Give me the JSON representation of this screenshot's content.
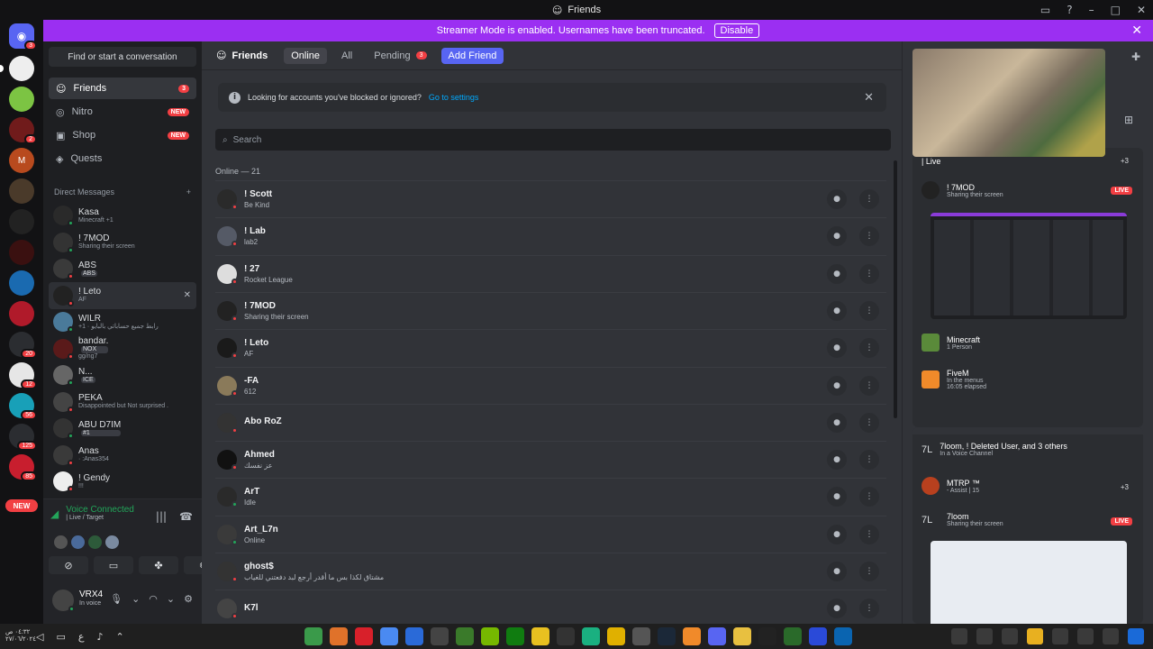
{
  "window": {
    "title": "Friends"
  },
  "banner": {
    "text": "Streamer Mode is enabled. Usernames have been truncated.",
    "disable_label": "Disable"
  },
  "servers": [
    {
      "badge": "3"
    },
    {
      "badge": ""
    },
    {
      "badge": ""
    },
    {
      "badge": "2"
    },
    {
      "badge": ""
    },
    {
      "badge": ""
    },
    {
      "badge": ""
    },
    {
      "badge": ""
    },
    {
      "badge": ""
    },
    {
      "badge": ""
    },
    {
      "badge": "20"
    },
    {
      "badge": "12"
    },
    {
      "badge": "56"
    },
    {
      "badge": "125"
    },
    {
      "badge": "85"
    },
    {
      "badge": ""
    }
  ],
  "servers_new_label": "NEW",
  "dm_sidebar": {
    "find_placeholder": "Find or start a conversation",
    "nav": [
      {
        "label": "Friends",
        "badge": "3"
      },
      {
        "label": "Nitro",
        "badge": "NEW"
      },
      {
        "label": "Shop",
        "badge": "NEW"
      },
      {
        "label": "Quests",
        "badge": ""
      }
    ],
    "dm_header": "Direct Messages",
    "dm_add": "+",
    "dms": [
      {
        "name": "Kasa",
        "sub": "Minecraft +1",
        "tag": "",
        "status": "online"
      },
      {
        "name": "! 7MOD",
        "sub": "Sharing their screen",
        "tag": "",
        "status": "online"
      },
      {
        "name": "ABS",
        "sub": "",
        "tag": "ABS",
        "status": "dnd"
      },
      {
        "name": "! Leto",
        "sub": "AF",
        "tag": "",
        "status": "dnd"
      },
      {
        "name": "WILR",
        "sub": "+1 · رابط جميع حساباتي بالبايو",
        "tag": "",
        "status": "online"
      },
      {
        "name": "bandar.",
        "sub": "gg/ng7",
        "tag": "NOX",
        "status": "dnd"
      },
      {
        "name": "N...",
        "sub": "",
        "tag": "ICE",
        "status": "online"
      },
      {
        "name": "PEKA",
        "sub": "Disappointed but Not surprised .",
        "tag": "",
        "status": "dnd"
      },
      {
        "name": "ABU D7IM",
        "sub": "",
        "tag": "#1",
        "status": "online"
      },
      {
        "name": "Anas",
        "sub": "· :Anas354",
        "tag": "",
        "status": "dnd"
      },
      {
        "name": "! Gendy",
        "sub": "!!!",
        "tag": "",
        "status": "dnd"
      }
    ]
  },
  "voice": {
    "title": "Voice Connected",
    "channel": "| Live / Target"
  },
  "user": {
    "name": "VRX4",
    "status": "In voice"
  },
  "toolbar": {
    "friends_label": "Friends",
    "tabs": [
      {
        "label": "Online",
        "badge": ""
      },
      {
        "label": "All",
        "badge": ""
      },
      {
        "label": "Pending",
        "badge": "3"
      }
    ],
    "add_friend_label": "Add Friend"
  },
  "notice": {
    "text": "Looking for accounts you've blocked or ignored?",
    "link": "Go to settings"
  },
  "search": {
    "placeholder": "Search"
  },
  "online_header": "Online — 21",
  "friends": [
    {
      "name": "! Scott",
      "sub": "Be Kind",
      "status": "dnd"
    },
    {
      "name": "! Lab",
      "sub": "lab2",
      "status": "dnd"
    },
    {
      "name": "! 27",
      "sub": "Rocket League",
      "status": "dnd"
    },
    {
      "name": "! 7MOD",
      "sub": "Sharing their screen",
      "status": "dnd"
    },
    {
      "name": "! Leto",
      "sub": "AF",
      "status": "dnd"
    },
    {
      "name": "-FA",
      "sub": "612",
      "status": "dnd"
    },
    {
      "name": "Abo RoZ",
      "sub": "",
      "status": "dnd"
    },
    {
      "name": "Ahmed",
      "sub": "عز نفسك",
      "status": "dnd"
    },
    {
      "name": "ArT",
      "sub": "Idle",
      "status": "online"
    },
    {
      "name": "Art_L7n",
      "sub": "Online",
      "status": "online"
    },
    {
      "name": "ghost$",
      "sub": "مشتاق لكذا بس ما أقدر أرجع لبد دفعتني للغياب",
      "status": "dnd"
    },
    {
      "name": "K7l",
      "sub": "",
      "status": "dnd"
    }
  ],
  "activity": {
    "card1_live_text": "| Live",
    "card1_more": "+3",
    "stream_user": "! 7MOD",
    "stream_sub": "Sharing their screen",
    "live_label": "LIVE",
    "games": [
      {
        "name": "Minecraft",
        "sub": "1 Person"
      },
      {
        "name": "FiveM",
        "sub": "In the menus",
        "sub2": "16:05 elapsed"
      }
    ],
    "card2_title": "7loom, ! Deleted User, and 3 others",
    "card2_sub": "In a Voice Channel",
    "server_name": "MTRP ™",
    "server_sub": "- Assist | 15",
    "server_more": "+3",
    "stream2_user": "7loom",
    "stream2_sub": "Sharing their screen"
  },
  "taskbar": {
    "time": "٠٤:٣٢ ص",
    "date": "٢٧/٠٦/٢٠٢٤"
  }
}
